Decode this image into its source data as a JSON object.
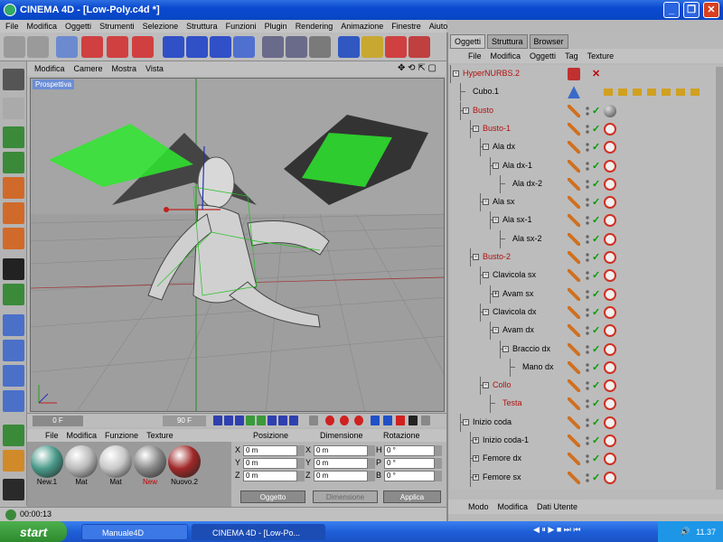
{
  "window": {
    "title": "CINEMA 4D - [Low-Poly.c4d *]"
  },
  "menubar": [
    "File",
    "Modifica",
    "Oggetti",
    "Strumenti",
    "Selezione",
    "Struttura",
    "Funzioni",
    "Plugin",
    "Rendering",
    "Animazione",
    "Finestre",
    "Aiuto"
  ],
  "viewport": {
    "menu": [
      "Modifica",
      "Camere",
      "Mostra",
      "Vista"
    ],
    "label": "Prospettiva"
  },
  "timeline": {
    "current": "0 F",
    "end": "90 F"
  },
  "materials": {
    "menu": [
      "File",
      "Modifica",
      "Funzione",
      "Texture"
    ],
    "items": [
      {
        "name": "New.1",
        "color": "#4a9a8a"
      },
      {
        "name": "Mat",
        "color": "#bbbbbb"
      },
      {
        "name": "Mat",
        "color": "#c8c8c8"
      },
      {
        "name": "New",
        "color": "#8a8a8a",
        "highlight": true
      },
      {
        "name": "Nuovo.2",
        "color": "#a02828"
      }
    ]
  },
  "coords": {
    "headers": [
      "Posizione",
      "Dimensione",
      "Rotazione"
    ],
    "rows": [
      {
        "a": "X",
        "av": "0 m",
        "b": "X",
        "bv": "0 m",
        "c": "H",
        "cv": "0 °"
      },
      {
        "a": "Y",
        "av": "0 m",
        "b": "Y",
        "bv": "0 m",
        "c": "P",
        "cv": "0 °"
      },
      {
        "a": "Z",
        "av": "0 m",
        "b": "Z",
        "bv": "0 m",
        "c": "B",
        "cv": "0 °"
      }
    ],
    "mode": "Oggetto",
    "dim_mode": "Dimensione",
    "apply": "Applica"
  },
  "status": {
    "time": "00:00:13"
  },
  "objects_panel": {
    "tabs": [
      "Oggetti",
      "Struttura",
      "Browser"
    ],
    "menu": [
      "File",
      "Modifica",
      "Oggetti",
      "Tag",
      "Texture"
    ],
    "items": [
      {
        "name": "HyperNURBS.2",
        "depth": 0,
        "red": true,
        "expand": "-"
      },
      {
        "name": "Cubo.1",
        "depth": 1,
        "red": false
      },
      {
        "name": "Busto",
        "depth": 1,
        "red": true,
        "expand": "-"
      },
      {
        "name": "Busto-1",
        "depth": 2,
        "red": true,
        "expand": "-"
      },
      {
        "name": "Ala dx",
        "depth": 3,
        "red": false,
        "expand": "-"
      },
      {
        "name": "Ala dx-1",
        "depth": 4,
        "red": false,
        "expand": "-"
      },
      {
        "name": "Ala dx-2",
        "depth": 5,
        "red": false
      },
      {
        "name": "Ala sx",
        "depth": 3,
        "red": false,
        "expand": "-"
      },
      {
        "name": "Ala sx-1",
        "depth": 4,
        "red": false,
        "expand": "-"
      },
      {
        "name": "Ala sx-2",
        "depth": 5,
        "red": false
      },
      {
        "name": "Busto-2",
        "depth": 2,
        "red": true,
        "expand": "-"
      },
      {
        "name": "Clavicola sx",
        "depth": 3,
        "red": false,
        "expand": "-"
      },
      {
        "name": "Avam sx",
        "depth": 4,
        "red": false,
        "expand": "+"
      },
      {
        "name": "Clavicola dx",
        "depth": 3,
        "red": false,
        "expand": "-"
      },
      {
        "name": "Avam dx",
        "depth": 4,
        "red": false,
        "expand": "-"
      },
      {
        "name": "Braccio dx",
        "depth": 5,
        "red": false,
        "expand": "-"
      },
      {
        "name": "Mano dx",
        "depth": 6,
        "red": false
      },
      {
        "name": "Collo",
        "depth": 3,
        "red": true,
        "expand": "-"
      },
      {
        "name": "Testa",
        "depth": 4,
        "red": true
      },
      {
        "name": "Inizio coda",
        "depth": 1,
        "red": false,
        "expand": "-"
      },
      {
        "name": "Inizio coda-1",
        "depth": 2,
        "red": false,
        "expand": "+"
      },
      {
        "name": "Femore dx",
        "depth": 2,
        "red": false,
        "expand": "+"
      },
      {
        "name": "Femore sx",
        "depth": 2,
        "red": false,
        "expand": "+"
      }
    ]
  },
  "attributes": {
    "menu": [
      "Modo",
      "Modifica",
      "Dati Utente"
    ]
  },
  "taskbar": {
    "start": "start",
    "tasks": [
      "Manuale4D",
      "CINEMA 4D - [Low-Po..."
    ],
    "clock": "11.37"
  }
}
